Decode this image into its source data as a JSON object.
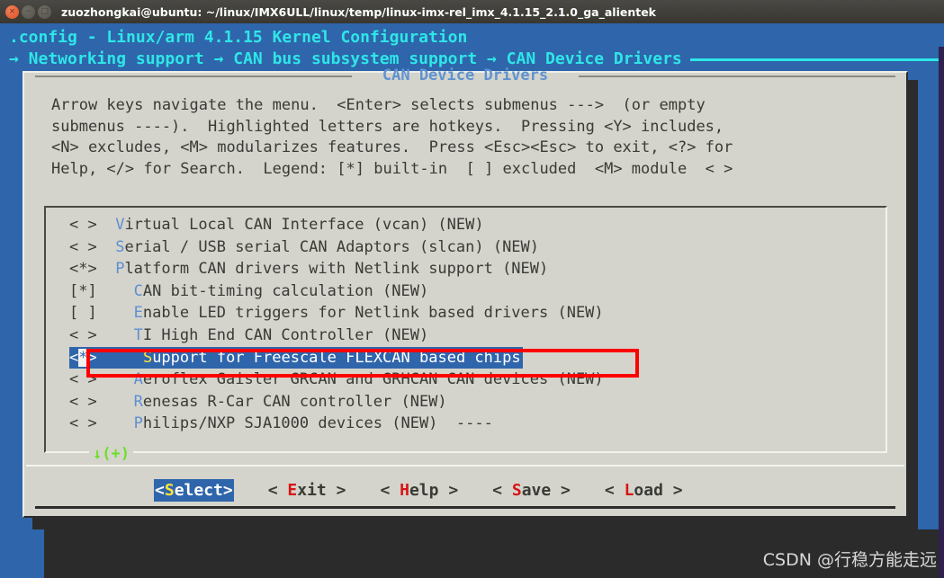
{
  "window": {
    "title": "zuozhongkai@ubuntu: ~/linux/IMX6ULL/linux/temp/linux-imx-rel_imx_4.1.15_2.1.0_ga_alientek",
    "controls": {
      "close": "×",
      "minimize": "−",
      "maximize": "□"
    }
  },
  "menuconfig": {
    "title_line": ".config - Linux/arm 4.1.15 Kernel Configuration",
    "breadcrumb": "→ Networking support → CAN bus subsystem support → CAN Device Drivers",
    "dialog_title": "CAN Device Drivers",
    "help_text": "Arrow keys navigate the menu.  <Enter> selects submenus --->  (or empty\nsubmenus ----).  Highlighted letters are hotkeys.  Pressing <Y> includes,\n<N> excludes, <M> modularizes features.  Press <Esc><Esc> to exit, <?> for\nHelp, </> for Search.  Legend: [*] built-in  [ ] excluded  <M> module  < >",
    "scroll_hint": "↓(+)",
    "menu_items": [
      {
        "state": "< >",
        "indent": "",
        "hotkey": "V",
        "label": "irtual Local CAN Interface (vcan) (NEW)",
        "selected": false
      },
      {
        "state": "< >",
        "indent": "",
        "hotkey": "S",
        "label": "erial / USB serial CAN Adaptors (slcan) (NEW)",
        "selected": false
      },
      {
        "state": "<*>",
        "indent": "",
        "hotkey": "P",
        "label": "latform CAN drivers with Netlink support (NEW)",
        "selected": false
      },
      {
        "state": "[*]",
        "indent": "  ",
        "hotkey": "C",
        "label": "AN bit-timing calculation (NEW)",
        "selected": false
      },
      {
        "state": "[ ]",
        "indent": "  ",
        "hotkey": "E",
        "label": "nable LED triggers for Netlink based drivers (NEW)",
        "selected": false
      },
      {
        "state": "< >",
        "indent": "  ",
        "hotkey": "T",
        "label": "I High End CAN Controller (NEW)",
        "selected": false
      },
      {
        "state": "<*>",
        "indent": "  ",
        "hotkey": "S",
        "label": "upport for Freescale FLEXCAN based chips",
        "selected": true
      },
      {
        "state": "< >",
        "indent": "  ",
        "hotkey": "A",
        "label": "eroflex Gaisler GRCAN and GRHCAN CAN devices (NEW)",
        "selected": false
      },
      {
        "state": "< >",
        "indent": "  ",
        "hotkey": "R",
        "label": "enesas R-Car CAN controller (NEW)",
        "selected": false
      },
      {
        "state": "< >",
        "indent": "  ",
        "hotkey": "P",
        "label": "hilips/NXP SJA1000 devices (NEW)  ----",
        "selected": false
      }
    ],
    "buttons": [
      {
        "pre": "<",
        "hotkey": "S",
        "post": "elect>",
        "active": true
      },
      {
        "pre": "< E",
        "hotkey": "x",
        "post": "it >",
        "active": false,
        "alt_pre": "< ",
        "alt_hotkey": "E",
        "alt_post": "xit >"
      },
      {
        "pre": "< ",
        "hotkey": "H",
        "post": "elp >",
        "active": false
      },
      {
        "pre": "< ",
        "hotkey": "S",
        "post": "ave >",
        "active": false
      },
      {
        "pre": "< ",
        "hotkey": "L",
        "post": "oad >",
        "active": false
      }
    ]
  },
  "annotation": {
    "highlight_color": "#ff0000",
    "target": "Support for Freescale FLEXCAN based chips"
  },
  "watermark": "CSDN @行稳方能走远",
  "colors": {
    "terminal_background": "#2f65ab",
    "dialog_background": "#d4d4cc",
    "accent_cyan": "#2ee6e6",
    "hotkey_blue": "#5f8fd0",
    "hotkey_red": "#d81414",
    "selected_background": "#2f65ab",
    "scroll_green": "#6ddf2a"
  }
}
